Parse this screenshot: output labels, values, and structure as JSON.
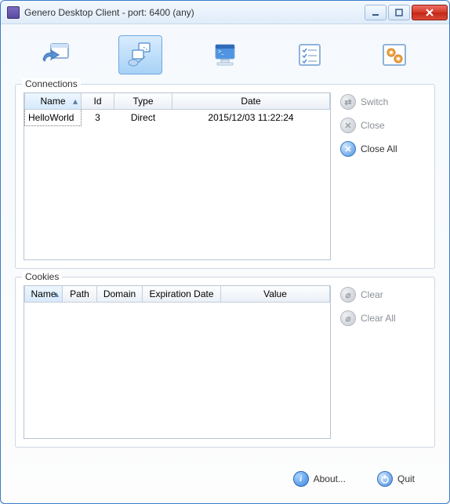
{
  "window": {
    "title": "Genero Desktop Client - port: 6400 (any)"
  },
  "toolbar": {
    "items": [
      {
        "name": "shortcut",
        "active": false
      },
      {
        "name": "connections",
        "active": true
      },
      {
        "name": "terminal",
        "active": false
      },
      {
        "name": "checklist",
        "active": false
      },
      {
        "name": "settings",
        "active": false
      }
    ]
  },
  "connections": {
    "label": "Connections",
    "columns": [
      "Name",
      "Id",
      "Type",
      "Date"
    ],
    "sort_column": 0,
    "rows": [
      {
        "name": "HelloWorld",
        "id": "3",
        "type": "Direct",
        "date": "2015/12/03 11:22:24"
      }
    ],
    "actions": {
      "switch": "Switch",
      "close": "Close",
      "close_all": "Close All"
    }
  },
  "cookies": {
    "label": "Cookies",
    "columns": [
      "Name",
      "Path",
      "Domain",
      "Expiration Date",
      "Value"
    ],
    "sort_column": 0,
    "rows": [],
    "actions": {
      "clear": "Clear",
      "clear_all": "Clear All"
    }
  },
  "footer": {
    "about": "About...",
    "quit": "Quit"
  }
}
